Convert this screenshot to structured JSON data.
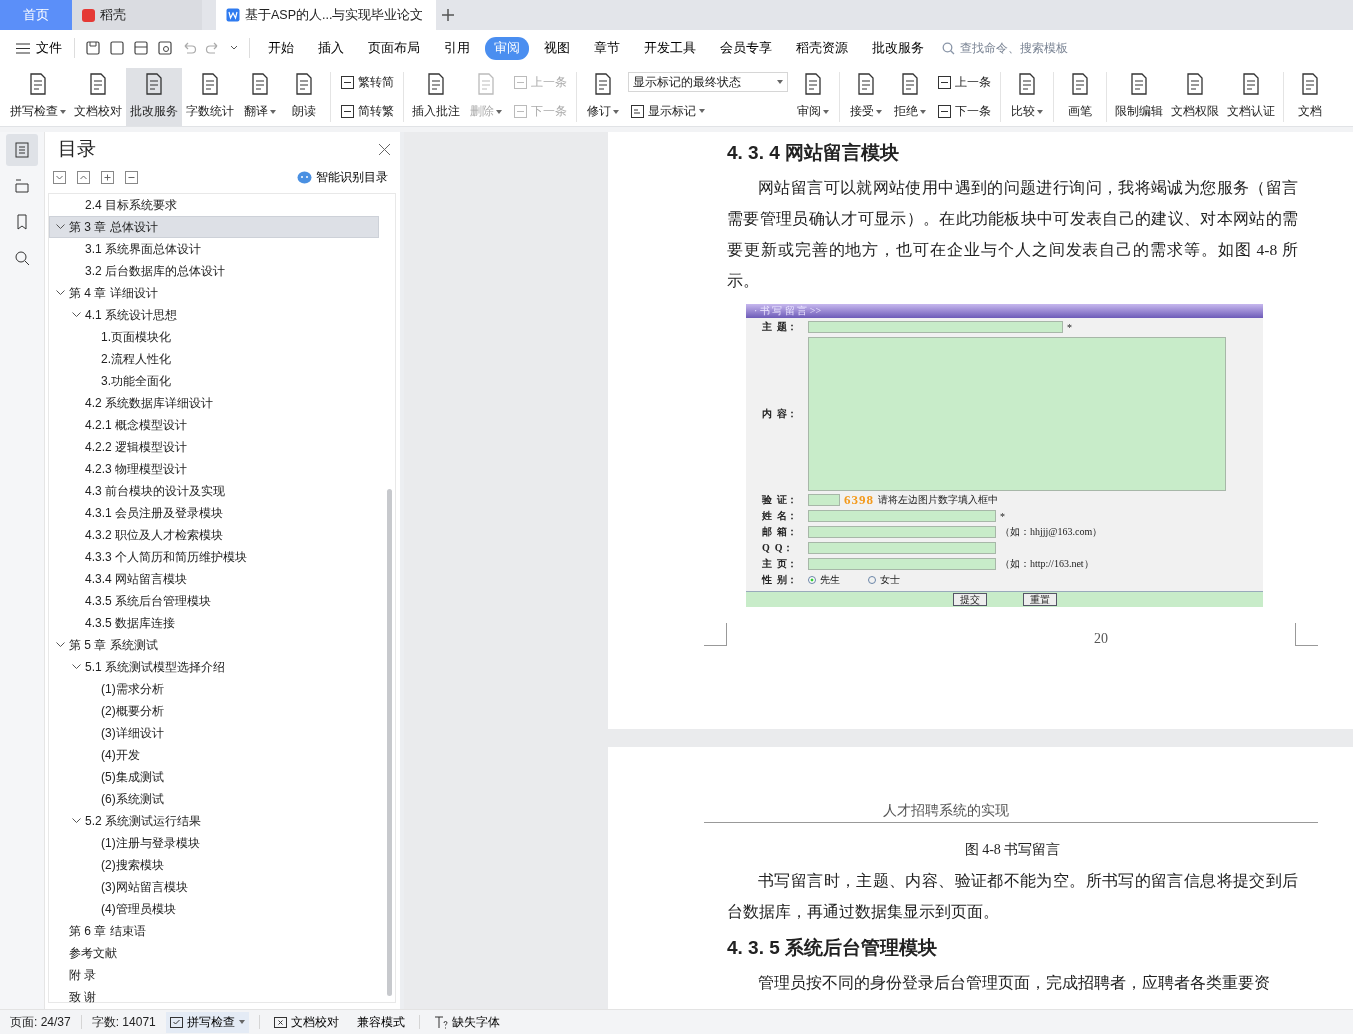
{
  "title_tabs": [
    {
      "kind": "home",
      "label": "首页",
      "selected": false
    },
    {
      "kind": "app",
      "label": "稻壳",
      "selected": false
    },
    {
      "kind": "doc",
      "label": "基于ASP的人...与实现毕业论文",
      "selected": true
    }
  ],
  "menu": {
    "file": "文件",
    "tabs": [
      {
        "label": "开始",
        "selected": false
      },
      {
        "label": "插入",
        "selected": false
      },
      {
        "label": "页面布局",
        "selected": false
      },
      {
        "label": "引用",
        "selected": false
      },
      {
        "label": "审阅",
        "selected": true
      },
      {
        "label": "视图",
        "selected": false
      },
      {
        "label": "章节",
        "selected": false
      },
      {
        "label": "开发工具",
        "selected": false
      },
      {
        "label": "会员专享",
        "selected": false
      },
      {
        "label": "稻壳资源",
        "selected": false
      },
      {
        "label": "批改服务",
        "selected": false
      }
    ],
    "search": {
      "placeholder": "查找命令、搜索模板"
    }
  },
  "ribbon": [
    {
      "kind": "big",
      "label": "拼写检查",
      "dropdown": true,
      "disabled": false,
      "highlighted": false
    },
    {
      "kind": "big",
      "label": "文档校对",
      "dropdown": false,
      "disabled": false,
      "highlighted": false
    },
    {
      "kind": "big",
      "label": "批改服务",
      "dropdown": false,
      "disabled": false,
      "highlighted": true
    },
    {
      "kind": "big",
      "label": "字数统计",
      "dropdown": false,
      "disabled": false,
      "highlighted": false
    },
    {
      "kind": "big",
      "label": "翻译",
      "dropdown": true,
      "disabled": false,
      "highlighted": false
    },
    {
      "kind": "big",
      "label": "朗读",
      "dropdown": false,
      "disabled": false,
      "highlighted": false
    },
    {
      "kind": "separator"
    },
    {
      "kind": "pair",
      "items": [
        {
          "label": "繁转简",
          "disabled": false
        },
        {
          "label": "简转繁",
          "disabled": false
        }
      ]
    },
    {
      "kind": "separator"
    },
    {
      "kind": "big",
      "label": "插入批注",
      "dropdown": false,
      "disabled": false,
      "highlighted": false
    },
    {
      "kind": "big",
      "label": "删除",
      "dropdown": true,
      "disabled": true,
      "highlighted": false
    },
    {
      "kind": "pair",
      "items": [
        {
          "label": "上一条",
          "disabled": true
        },
        {
          "label": "下一条",
          "disabled": true
        }
      ]
    },
    {
      "kind": "separator"
    },
    {
      "kind": "big",
      "label": "修订",
      "dropdown": true,
      "disabled": false,
      "highlighted": false
    },
    {
      "kind": "select",
      "value": "显示标记的最终状态",
      "button": "显示标记"
    },
    {
      "kind": "big",
      "label": "审阅",
      "dropdown": true,
      "disabled": false,
      "highlighted": false
    },
    {
      "kind": "separator"
    },
    {
      "kind": "big",
      "label": "接受",
      "dropdown": true,
      "disabled": false,
      "highlighted": false
    },
    {
      "kind": "big",
      "label": "拒绝",
      "dropdown": true,
      "disabled": false,
      "highlighted": false
    },
    {
      "kind": "pair",
      "items": [
        {
          "label": "上一条",
          "disabled": false
        },
        {
          "label": "下一条",
          "disabled": false
        }
      ]
    },
    {
      "kind": "separator"
    },
    {
      "kind": "big",
      "label": "比较",
      "dropdown": true,
      "disabled": false,
      "highlighted": false
    },
    {
      "kind": "separator"
    },
    {
      "kind": "big",
      "label": "画笔",
      "dropdown": false,
      "disabled": false,
      "highlighted": false
    },
    {
      "kind": "separator"
    },
    {
      "kind": "big",
      "label": "限制编辑",
      "dropdown": false,
      "disabled": false,
      "highlighted": false
    },
    {
      "kind": "big",
      "label": "文档权限",
      "dropdown": false,
      "disabled": false,
      "highlighted": false
    },
    {
      "kind": "big",
      "label": "文档认证",
      "dropdown": false,
      "disabled": false,
      "highlighted": false
    },
    {
      "kind": "separator"
    },
    {
      "kind": "big",
      "label": "文档",
      "dropdown": false,
      "disabled": false,
      "highlighted": false
    }
  ],
  "rail": [
    {
      "selected": true
    },
    {
      "selected": false
    },
    {
      "selected": false
    },
    {
      "selected": false
    }
  ],
  "toc": {
    "title": "目录",
    "smart_button": "智能识别目录",
    "items": [
      {
        "kind": "section",
        "label": "2.4 目标系统要求",
        "selected": false
      },
      {
        "kind": "chapter",
        "label": "第 3 章  总体设计",
        "selected": true,
        "expanded": true,
        "children": [
          {
            "label": "3.1 系统界面总体设计",
            "selected": false
          },
          {
            "label": "3.2  后台数据库的总体设计",
            "selected": false
          }
        ]
      },
      {
        "kind": "chapter",
        "label": "第 4 章  详细设计",
        "selected": false,
        "expanded": true,
        "children": [
          {
            "label": "4.1 系统设计思想",
            "selected": false,
            "expanded": true,
            "children": [
              {
                "label": "1.页面模块化",
                "selected": false
              },
              {
                "label": "2.流程人性化",
                "selected": false
              },
              {
                "label": "3.功能全面化",
                "selected": false
              }
            ]
          },
          {
            "label": "4.2 系统数据库详细设计",
            "selected": false
          },
          {
            "label": "4.2.1 概念模型设计",
            "selected": false
          },
          {
            "label": "4.2.2 逻辑模型设计",
            "selected": false
          },
          {
            "label": "4.2.3 物理模型设计",
            "selected": false
          },
          {
            "label": "4.3 前台模块的设计及实现",
            "selected": false
          },
          {
            "label": "4.3.1 会员注册及登录模块",
            "selected": false
          },
          {
            "label": "4.3.2 职位及人才检索模块",
            "selected": false
          },
          {
            "label": "4.3.3 个人简历和简历维护模块",
            "selected": false
          },
          {
            "label": "4.3.4 网站留言模块",
            "selected": false
          },
          {
            "label": "4.3.5 系统后台管理模块",
            "selected": false
          },
          {
            "label": "4.3.5 数据库连接",
            "selected": false
          }
        ]
      },
      {
        "kind": "chapter",
        "label": "第 5 章  系统测试",
        "selected": false,
        "expanded": true,
        "children": [
          {
            "label": "5.1 系统测试模型选择介绍",
            "selected": false,
            "expanded": true,
            "children": [
              {
                "label": "(1)需求分析",
                "selected": false
              },
              {
                "label": "(2)概要分析",
                "selected": false
              },
              {
                "label": "(3)详细设计",
                "selected": false
              },
              {
                "label": "(4)开发",
                "selected": false
              },
              {
                "label": "(5)集成测试",
                "selected": false
              },
              {
                "label": "(6)系统测试",
                "selected": false
              }
            ]
          },
          {
            "label": "5.2 系统测试运行结果",
            "selected": false,
            "expanded": true,
            "children": [
              {
                "label": "(1)注册与登录模块",
                "selected": false
              },
              {
                "label": "(2)搜索模块",
                "selected": false
              },
              {
                "label": "(3)网站留言模块",
                "selected": false
              },
              {
                "label": "(4)管理员模块",
                "selected": false
              }
            ]
          }
        ]
      },
      {
        "kind": "chapter",
        "label": "第 6 章 结束语",
        "selected": false
      },
      {
        "kind": "chapter",
        "label": "参考文献",
        "selected": false
      },
      {
        "kind": "chapter",
        "label": "附  录",
        "selected": false
      },
      {
        "kind": "chapter",
        "label": "致  谢",
        "selected": false
      }
    ]
  },
  "page1": {
    "heading": "4. 3. 4  网站留言模块",
    "paragraph": "网站留言可以就网站使用中遇到的问题进行询问，我将竭诚为您服务（留言需要管理员确认才可显示）。在此功能板块中可发表自己的建议、对本网站的需要更新或完善的地方，也可在企业与个人之间发表自己的需求等。如图 4-8 所示。",
    "figure": {
      "title": "· 书 写 留 言 >>",
      "fields": [
        {
          "kind": "text",
          "label": "主  题：",
          "note": "*"
        },
        {
          "kind": "textarea",
          "label": "内  容："
        },
        {
          "kind": "captcha",
          "label": "验  证：",
          "code": "6398",
          "note": "请将左边图片数字填入框中"
        },
        {
          "kind": "text",
          "label": "姓  名：",
          "note": "*"
        },
        {
          "kind": "text",
          "label": "邮  箱：",
          "note": "（如：hhjjj@163.com）"
        },
        {
          "kind": "text",
          "label": "Q  Q："
        },
        {
          "kind": "text",
          "label": "主  页：",
          "note": "（如：http://163.net）"
        },
        {
          "kind": "radio",
          "label": "性  别：",
          "options": [
            {
              "label": "先生",
              "selected": true
            },
            {
              "label": "女士",
              "selected": false
            }
          ]
        }
      ],
      "buttons": [
        "提交",
        "重置"
      ]
    },
    "page_number": "20"
  },
  "page2": {
    "header": "人才招聘系统的实现",
    "caption": "图 4-8 书写留言",
    "paragraph1": "书写留言时，主题、内容、验证都不能为空。所书写的留言信息将提交到后台数据库，再通过数据集显示到页面。",
    "heading": "4. 3. 5  系统后台管理模块",
    "paragraph2": "管理员按不同的身份登录后台管理页面，完成招聘者，应聘者各类重要资"
  },
  "status_bar": {
    "page": "页面: 24/37",
    "words": "字数: 14071",
    "spell": "拼写检查",
    "proof": "文档校对",
    "mode": "兼容模式",
    "fonts": "缺失字体"
  }
}
